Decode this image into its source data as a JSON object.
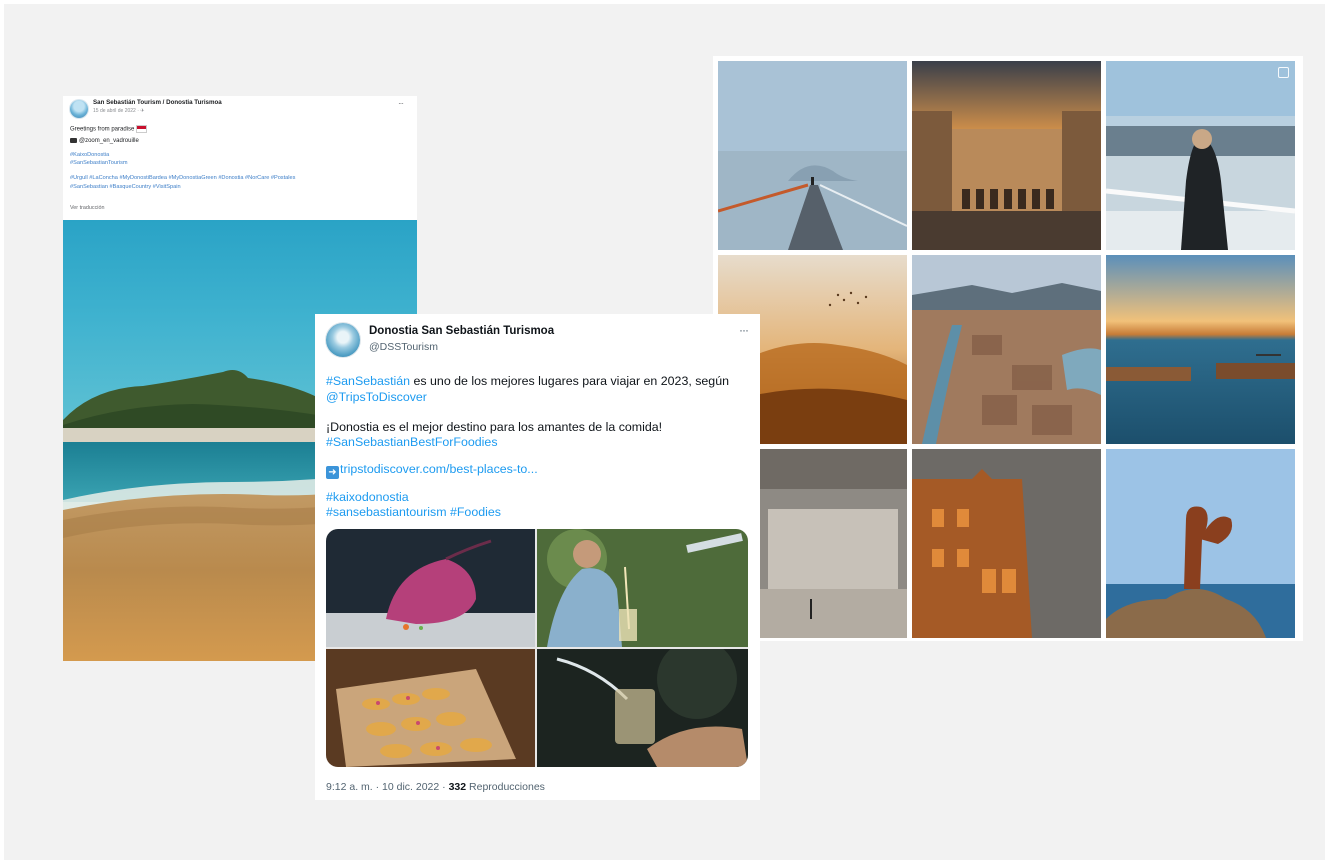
{
  "facebook_post": {
    "page_name": "San Sebastián Tourism / Donostia Turismoa",
    "date": "15 de abril de 2022 · ✈",
    "text_line1": "Greetings from paradise",
    "credit": "@zoom_en_vadrouille",
    "hashtags_line1": "#KaixoDonostia",
    "hashtags_line2": "#SanSebastianTourism",
    "hashtags_line3": "#Urgull #LaConcha #MyDonostiBardea #MyDonostiaGreen #Donostia #NorCare #Postales",
    "hashtags_line4": "#SanSebastian #BasqueCountry #VisitSpain",
    "see_translation": "Ver traducción",
    "more_icon": "···"
  },
  "twitter_post": {
    "display_name": "Donostia San Sebastián Turismoa",
    "handle": "@DSSTourism",
    "more_icon": "···",
    "line1_link": "#SanSebastián",
    "line1_text": " es uno de los mejores lugares para viajar en 2023, según",
    "line2_link": "@TripsToDiscover",
    "line3_text": "¡Donostia es el mejor destino para los amantes de la comida!",
    "line4_link": "#SanSebastianBestForFoodies",
    "url_text": "tripstodiscover.com/best-places-to...",
    "hashtag1": "#kaixodonostia",
    "hashtag2": "#sansebastiantourism #Foodies",
    "timestamp": "9:12 a. m. · 10 dic. 2022 · ",
    "views_count": "332",
    "views_label": " Reproducciones"
  },
  "instagram_grid": {
    "tiles": [
      "misty-pier",
      "plaza-constitucion-sunset",
      "woman-at-railing",
      "golden-mist-birds",
      "aerial-city-river",
      "harbor-sunset",
      "beach-surfer-fog",
      "ornate-building-golden",
      "peine-del-viento-sculpture"
    ]
  },
  "colors": {
    "twitter_link": "#1d9bf0",
    "facebook_link": "#3e7fc8",
    "canvas": "#f2f2f2"
  }
}
